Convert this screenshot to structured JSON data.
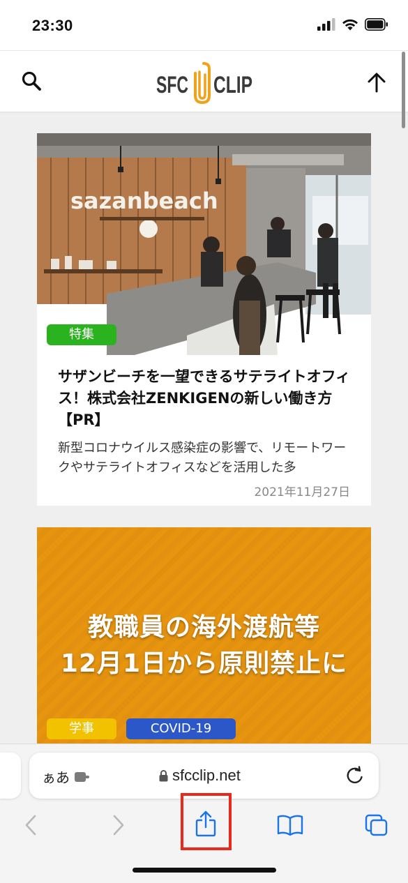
{
  "status_bar": {
    "time": "23:30"
  },
  "header": {
    "logo_text_left": "SFC",
    "logo_text_right": "CLIP"
  },
  "articles": [
    {
      "badges": [
        "特集"
      ],
      "image_sign_text": "sazanbeach",
      "title": "サザンビーチを一望できるサテライトオフィス！株式会社ZENKIGENの新しい働き方【PR】",
      "excerpt": "新型コロナウイルス感染症の影響で、リモートワークやサテライトオフィスなどを活用した多",
      "date": "2021年11月27日"
    },
    {
      "badges": [
        "学事",
        "COVID-19"
      ],
      "image_text_line1": "教職員の海外渡航等",
      "image_text_line2": "12月1日から原則禁止に"
    }
  ],
  "safari": {
    "aa_label": "ぁあ",
    "url": "sfcclip.net"
  },
  "colors": {
    "badge_feature": "#2bb31f",
    "badge_academic": "#f2c200",
    "badge_covid": "#2b57c9",
    "logo_accent": "#f0a21a",
    "ios_blue": "#1a73e8",
    "highlight_red": "#e8291c"
  }
}
